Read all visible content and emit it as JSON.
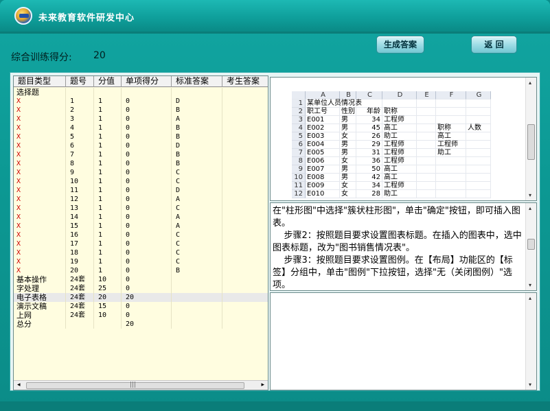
{
  "window": {
    "title": "未来教育软件研发中心"
  },
  "toolbar": {
    "generate_answer": "生成答案",
    "back": "返 回"
  },
  "score": {
    "label": "综合训练得分:",
    "value": "20"
  },
  "table": {
    "columns": [
      "题目类型",
      "题号",
      "分值",
      "单项得分",
      "标准答案",
      "考生答案"
    ],
    "rows": [
      [
        "选择题",
        "",
        "",
        "",
        "",
        ""
      ],
      [
        "X",
        "1",
        "1",
        "0",
        "D",
        ""
      ],
      [
        "X",
        "2",
        "1",
        "0",
        "B",
        ""
      ],
      [
        "X",
        "3",
        "1",
        "0",
        "A",
        ""
      ],
      [
        "X",
        "4",
        "1",
        "0",
        "B",
        ""
      ],
      [
        "X",
        "5",
        "1",
        "0",
        "B",
        ""
      ],
      [
        "X",
        "6",
        "1",
        "0",
        "D",
        ""
      ],
      [
        "X",
        "7",
        "1",
        "0",
        "B",
        ""
      ],
      [
        "X",
        "8",
        "1",
        "0",
        "B",
        ""
      ],
      [
        "X",
        "9",
        "1",
        "0",
        "C",
        ""
      ],
      [
        "X",
        "10",
        "1",
        "0",
        "C",
        ""
      ],
      [
        "X",
        "11",
        "1",
        "0",
        "D",
        ""
      ],
      [
        "X",
        "12",
        "1",
        "0",
        "A",
        ""
      ],
      [
        "X",
        "13",
        "1",
        "0",
        "C",
        ""
      ],
      [
        "X",
        "14",
        "1",
        "0",
        "A",
        ""
      ],
      [
        "X",
        "15",
        "1",
        "0",
        "A",
        ""
      ],
      [
        "X",
        "16",
        "1",
        "0",
        "C",
        ""
      ],
      [
        "X",
        "17",
        "1",
        "0",
        "C",
        ""
      ],
      [
        "X",
        "18",
        "1",
        "0",
        "C",
        ""
      ],
      [
        "X",
        "19",
        "1",
        "0",
        "C",
        ""
      ],
      [
        "X",
        "20",
        "1",
        "0",
        "B",
        ""
      ],
      [
        "基本操作",
        "24套",
        "10",
        "0",
        "",
        ""
      ],
      [
        "字处理",
        "24套",
        "25",
        "0",
        "",
        ""
      ],
      [
        "电子表格",
        "24套",
        "20",
        "20",
        "",
        ""
      ],
      [
        "演示文稿",
        "24套",
        "15",
        "0",
        "",
        ""
      ],
      [
        "上网",
        "24套",
        "10",
        "0",
        "",
        ""
      ],
      [
        "总分",
        "",
        "",
        "20",
        "",
        ""
      ]
    ],
    "selected_row": 23,
    "scroll_arrow_left": "◂",
    "scroll_arrow_right": "▸",
    "scroll_grip": "|||"
  },
  "sheet": {
    "col_headers": [
      "",
      "A",
      "B",
      "C",
      "D",
      "E",
      "F",
      "G"
    ],
    "rows": [
      [
        "1",
        "某单位人员情况表",
        "",
        "",
        "",
        "",
        "",
        ""
      ],
      [
        "2",
        "职工号",
        "性别",
        "年龄",
        "职称",
        "",
        "",
        ""
      ],
      [
        "3",
        "E001",
        "男",
        "34",
        "工程师",
        "",
        "",
        ""
      ],
      [
        "4",
        "E002",
        "男",
        "45",
        "高工",
        "",
        "职称",
        "人数"
      ],
      [
        "5",
        "E003",
        "女",
        "26",
        "助工",
        "",
        "高工",
        ""
      ],
      [
        "6",
        "E004",
        "男",
        "29",
        "工程师",
        "",
        "工程师",
        ""
      ],
      [
        "7",
        "E005",
        "男",
        "31",
        "工程师",
        "",
        "助工",
        ""
      ],
      [
        "8",
        "E006",
        "女",
        "36",
        "工程师",
        "",
        "",
        ""
      ],
      [
        "9",
        "E007",
        "男",
        "50",
        "高工",
        "",
        "",
        ""
      ],
      [
        "10",
        "E008",
        "男",
        "42",
        "高工",
        "",
        "",
        ""
      ],
      [
        "11",
        "E009",
        "女",
        "34",
        "工程师",
        "",
        "",
        ""
      ],
      [
        "12",
        "E010",
        "女",
        "28",
        "助工",
        "",
        "",
        ""
      ]
    ]
  },
  "explanation": {
    "text": "在\"柱形图\"中选择\"簇状柱形图\"，单击\"确定\"按钮，即可插入图表。\n    步骤2：按照题目要求设置图表标题。在插入的图表中，选中图表标题，改为\"图书销售情况表\"。\n    步骤3：按照题目要求设置图例。在【布局】功能区的【标签】分组中，单击\"图例\"下拉按钮，选择\"无（关闭图例）\"选项。"
  },
  "scroll": {
    "up": "▴",
    "down": "▾"
  }
}
